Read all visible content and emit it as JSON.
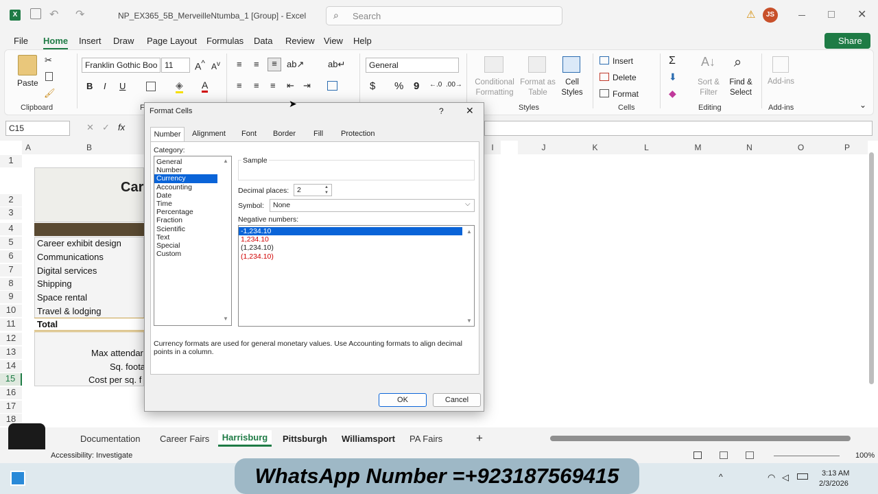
{
  "titlebar": {
    "file_name": "NP_EX365_5B_MerveilleNtumba_1 [Group] - Excel",
    "search_placeholder": "Search",
    "user_initials": "JS"
  },
  "menu_tabs": [
    "File",
    "Home",
    "Insert",
    "Draw",
    "Page Layout",
    "Formulas",
    "Data",
    "Review",
    "View",
    "Help"
  ],
  "share_label": "Share",
  "ribbon": {
    "clipboard": {
      "paste": "Paste",
      "label": "Clipboard"
    },
    "font": {
      "name": "Franklin Gothic Boo",
      "size": "11",
      "group_label": "F"
    },
    "number": {
      "format": "General",
      "symbols": [
        "$",
        "%",
        "9"
      ]
    },
    "styles": {
      "conditional": "Conditional Formatting",
      "format_table": "Format as Table",
      "cell_styles": "Cell Styles",
      "label": "Styles"
    },
    "cells": {
      "insert": "Insert",
      "delete": "Delete",
      "format": "Format",
      "label": "Cells"
    },
    "editing": {
      "sort": "Sort & Filter",
      "find": "Find & Select",
      "label": "Editing"
    },
    "addins": {
      "btn": "Add-ins",
      "label": "Add-ins"
    }
  },
  "formula_bar": {
    "name_box": "C15",
    "fx": "fx"
  },
  "columns": [
    "A",
    "B",
    "I",
    "J",
    "K",
    "L",
    "M",
    "N",
    "O",
    "P"
  ],
  "rows": [
    "1",
    "2",
    "3",
    "4",
    "5",
    "6",
    "7",
    "8",
    "9",
    "10",
    "11",
    "12",
    "13",
    "14",
    "15",
    "16",
    "17",
    "18"
  ],
  "cells": {
    "title_fragment": "Car",
    "r5": "Career exhibit design",
    "r6": "Communications",
    "r7": "Digital services",
    "r8": "Shipping",
    "r9": "Space rental",
    "r10": "Travel & lodging",
    "r11": "Total",
    "r13": "Max attendar",
    "r14": "Sq. foota",
    "r15": "Cost per sq. f"
  },
  "dialog": {
    "title": "Format Cells",
    "help": "?",
    "close": "✕",
    "tabs": [
      "Number",
      "Alignment",
      "Font",
      "Border",
      "Fill",
      "Protection"
    ],
    "category_label": "Category:",
    "categories": [
      "General",
      "Number",
      "Currency",
      "Accounting",
      "Date",
      "Time",
      "Percentage",
      "Fraction",
      "Scientific",
      "Text",
      "Special",
      "Custom"
    ],
    "selected_category": "Currency",
    "sample_label": "Sample",
    "decimal_label": "Decimal places:",
    "decimal_value": "2",
    "symbol_label": "Symbol:",
    "symbol_value": "None",
    "negative_label": "Negative numbers:",
    "negatives": [
      "-1,234.10",
      "1,234.10",
      "(1,234.10)",
      "(1,234.10)"
    ],
    "description": "Currency formats are used for general monetary values.  Use Accounting formats to align decimal points in a column.",
    "ok": "OK",
    "cancel": "Cancel"
  },
  "sheets": [
    "Documentation",
    "Career Fairs",
    "Harrisburg",
    "Pittsburgh",
    "Williamsport",
    "PA Fairs"
  ],
  "active_sheet": "Harrisburg",
  "status": {
    "accessibility": "Accessibility: Investigate",
    "zoom": "100%"
  },
  "taskbar": {
    "time": "3:13 AM",
    "date": "2/3/2026"
  },
  "watermark": "WhatsApp Number =+923187569415",
  "colors": {
    "excel_green": "#1e7b45",
    "selection_blue": "#0a64d8",
    "negative_red": "#d00000"
  }
}
